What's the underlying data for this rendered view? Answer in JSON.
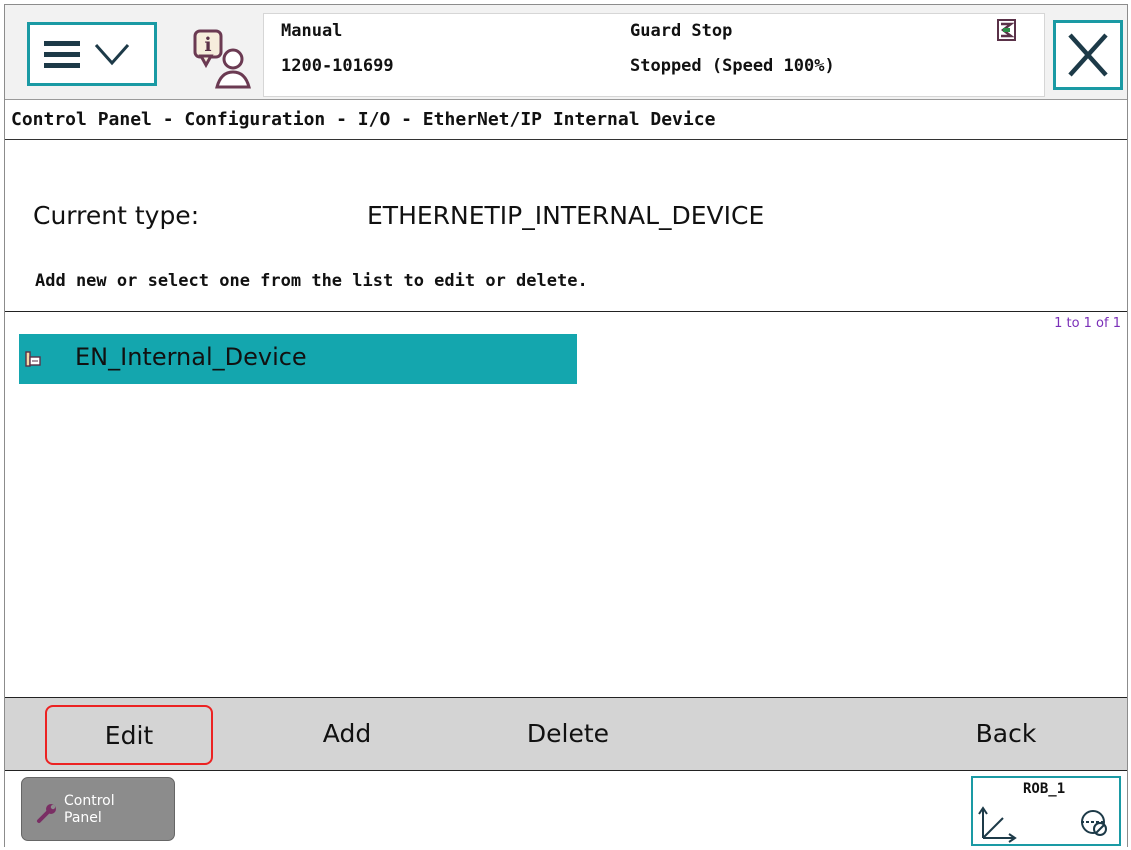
{
  "header": {
    "operating_mode": "Manual",
    "system_name": "1200-101699",
    "safety_state": "Guard Stop",
    "program_state": "Stopped (Speed 100%)"
  },
  "icons": {
    "menu": "hamburger-chevron-icon",
    "user_info": "user-info-icon",
    "status_flag": "flag-icon",
    "close": "close-icon",
    "device": "io-device-icon",
    "control_panel": "wrench-icon",
    "robot": "robot-coordinate-icon"
  },
  "breadcrumb": "Control Panel - Configuration - I/O - EtherNet/IP Internal Device",
  "current_type": {
    "label": "Current type:",
    "value": "ETHERNETIP_INTERNAL_DEVICE"
  },
  "instructions": "Add new or select one from the list to edit or delete.",
  "list": {
    "count": "1 to 1 of 1",
    "items": [
      {
        "label": "EN_Internal_Device",
        "selected": true
      }
    ]
  },
  "commands": {
    "edit": "Edit",
    "add": "Add",
    "delete": "Delete",
    "back": "Back"
  },
  "taskbar": {
    "control_panel_line1": "Control",
    "control_panel_line2": "Panel",
    "robot": "ROB_1"
  },
  "colors": {
    "accent": "#1a9aa4",
    "selection": "#14a6ae",
    "highlight_border": "#ec2222",
    "count_text": "#7a2fb8"
  }
}
